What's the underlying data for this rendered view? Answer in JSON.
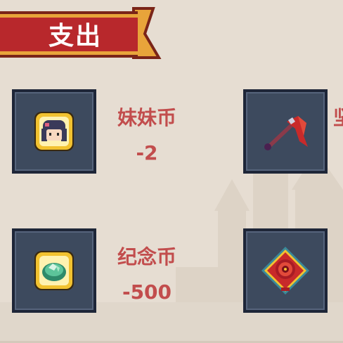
{
  "header": {
    "title": "支出"
  },
  "items": [
    {
      "name": "妹妹币",
      "amount": "-2",
      "icon": "girl-portrait-coin-icon"
    },
    {
      "name": "坚",
      "amount": "",
      "icon": "red-halberd-icon"
    },
    {
      "name": "纪念币",
      "amount": "-500",
      "icon": "green-gem-coin-icon"
    },
    {
      "name": "",
      "amount": "",
      "icon": "red-ornament-diamond-icon"
    }
  ],
  "colors": {
    "banner_red": "#b8282c",
    "banner_gold": "#e8a43a",
    "tile_fill": "#3d4a5e",
    "tile_border": "#1e2638",
    "label_red": "#c24d4d",
    "background": "#e6ddd2"
  }
}
